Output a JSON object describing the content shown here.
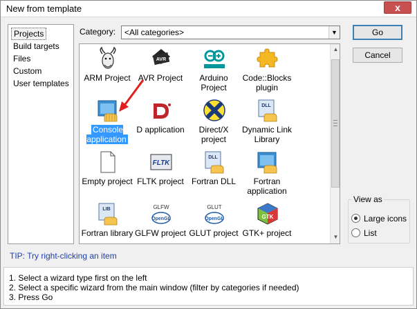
{
  "window": {
    "title": "New from template",
    "close_label": "x"
  },
  "categories_list": [
    {
      "label": "Projects",
      "selected": true
    },
    {
      "label": "Build targets",
      "selected": false
    },
    {
      "label": "Files",
      "selected": false
    },
    {
      "label": "Custom",
      "selected": false
    },
    {
      "label": "User templates",
      "selected": false
    }
  ],
  "category": {
    "label": "Category:",
    "value": "<All categories>"
  },
  "templates": [
    {
      "label": "ARM Project",
      "icon": "gnu-icon"
    },
    {
      "label": "AVR Project",
      "icon": "avr-chip-icon"
    },
    {
      "label": "Arduino Project",
      "icon": "arduino-icon"
    },
    {
      "label": "Code::Blocks plugin",
      "icon": "puzzle-piece-icon"
    },
    {
      "label": "Console application",
      "icon": "console-app-icon",
      "selected": true
    },
    {
      "label": "D application",
      "icon": "d-language-icon"
    },
    {
      "label": "Direct/X project",
      "icon": "directx-icon"
    },
    {
      "label": "Dynamic Link Library",
      "icon": "dll-icon"
    },
    {
      "label": "Empty project",
      "icon": "blank-file-icon"
    },
    {
      "label": "FLTK project",
      "icon": "fltk-icon"
    },
    {
      "label": "Fortran DLL",
      "icon": "fortran-dll-icon"
    },
    {
      "label": "Fortran application",
      "icon": "fortran-app-icon"
    },
    {
      "label": "Fortran library",
      "icon": "fortran-lib-icon"
    },
    {
      "label": "GLFW project",
      "icon": "glfw-icon"
    },
    {
      "label": "GLUT project",
      "icon": "glut-icon"
    },
    {
      "label": "GTK+ project",
      "icon": "gtk-icon"
    }
  ],
  "buttons": {
    "go": "Go",
    "cancel": "Cancel"
  },
  "view_as": {
    "legend": "View as",
    "options": [
      {
        "label": "Large icons",
        "checked": true
      },
      {
        "label": "List",
        "checked": false
      }
    ]
  },
  "tip": "TIP: Try right-clicking an item",
  "instructions": [
    "1. Select a wizard type first on the left",
    "2. Select a specific wizard from the main window (filter by categories if needed)",
    "3. Press Go"
  ]
}
